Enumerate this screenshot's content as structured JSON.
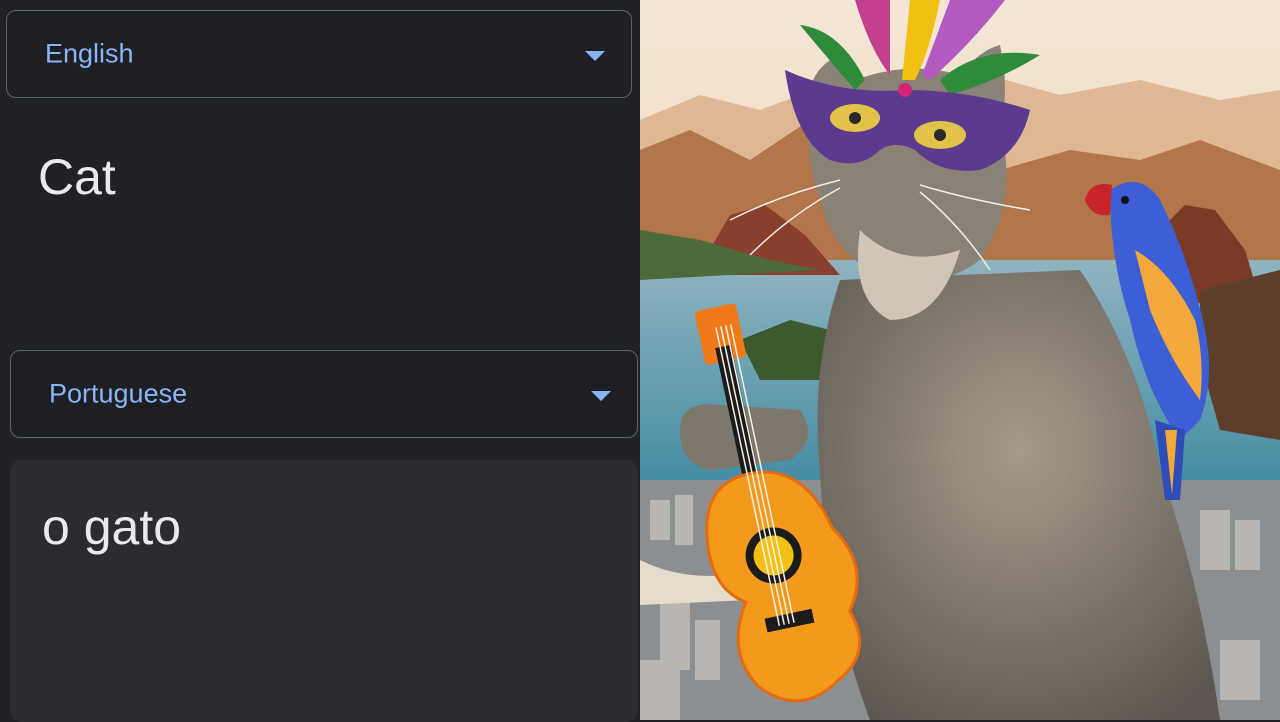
{
  "source": {
    "language": "English",
    "text": "Cat"
  },
  "target": {
    "language": "Portuguese",
    "text": "o gato"
  },
  "image": {
    "icons": [
      "chevron-down-icon"
    ]
  }
}
